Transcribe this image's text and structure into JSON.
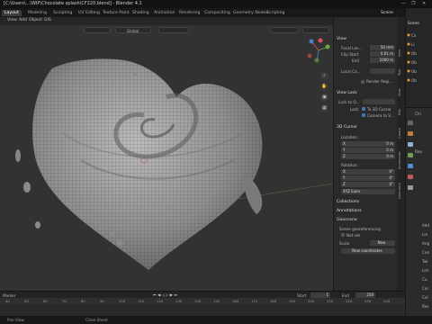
{
  "window": {
    "title": "[C:\\Users\\...\\WIP\\Chocolate splash\\CF220.blend] - Blender 4.1",
    "controls": [
      "—",
      "❐",
      "✕"
    ]
  },
  "workspace_tabs": [
    {
      "label": "Layout",
      "active": true
    },
    {
      "label": "Modeling",
      "active": false
    },
    {
      "label": "Sculpting",
      "active": false
    },
    {
      "label": "UV Editing",
      "active": false
    },
    {
      "label": "Texture Paint",
      "active": false
    },
    {
      "label": "Shading",
      "active": false
    },
    {
      "label": "Animation",
      "active": false
    },
    {
      "label": "Rendering",
      "active": false
    },
    {
      "label": "Compositing",
      "active": false
    },
    {
      "label": "Geometry Nodes",
      "active": false
    },
    {
      "label": "Scripting",
      "active": false
    }
  ],
  "scene_label": "Scene",
  "viewport_menu": [
    "View",
    "Add",
    "Object",
    "GIS"
  ],
  "transform_orientation": "Global",
  "n_panel": {
    "view_header": "View",
    "focal_label": "Focal Len...",
    "focal_value": "50 mm",
    "clip_header": "Clip Start",
    "clip_start_value": "0.01 m",
    "clip_end_label": "End",
    "clip_end_value": "1000 m",
    "local_camera_label": "Local Ca...",
    "render_region_label": "Render Regi...",
    "view_lock_header": "View Lock",
    "lock_to_obj_label": "Lock to O...",
    "lock_label": "Lock",
    "to_3d_cursor": "To 3D Cursor",
    "camera_to_view": "Camera to V...",
    "cursor_header": "3D Cursor",
    "location_label": "Location:",
    "loc_x": "X",
    "loc_x_val": "0 m",
    "loc_y": "Y",
    "loc_y_val": "0 m",
    "loc_z": "Z",
    "loc_z_val": "0 m",
    "rotation_label": "Rotation:",
    "rot_x": "X",
    "rot_x_val": "0°",
    "rot_y": "Y",
    "rot_y_val": "0°",
    "rot_z": "Z",
    "rot_z_val": "0°",
    "rotation_mode": "XYZ Euler",
    "collections_header": "Collections",
    "annotations_header": "Annotations",
    "georeferencing_header": "Geoscene",
    "geo_row1": "Scene georeferencing",
    "geo_row2": "Not set",
    "geo_crs_label": "Scale",
    "geo_new_btn": "New",
    "geo_row3": "New coordinates"
  },
  "side_tabs": [
    "Item",
    "Tool",
    "View",
    "Edit",
    "Create",
    "Screencast",
    "Geometry"
  ],
  "outliner_items": [
    "Scene",
    "Ca",
    "Li",
    "Ob",
    "Ob",
    "Ob",
    "Ob"
  ],
  "props_items": [
    "Chi",
    "Rea",
    "Add",
    "Lin",
    "Ang",
    "Con",
    "Twi",
    "Lim",
    "Cu",
    "Col",
    "Col",
    "Res"
  ],
  "timeline": {
    "marker_label": "Marker",
    "ticks": [
      "40",
      "50",
      "60",
      "70",
      "80",
      "90",
      "100",
      "110",
      "120",
      "130",
      "140",
      "150",
      "160",
      "170",
      "180",
      "190",
      "200",
      "210",
      "220",
      "230",
      "240"
    ],
    "start_label": "Start",
    "start_value": "1",
    "end_label": "End",
    "end_value": "250"
  },
  "status": {
    "left": "Pan View",
    "right": "Close Sheet"
  },
  "colors": {
    "accent": "#4772b3",
    "mesh_fill": "#9a9a9a",
    "wire": "#2b2b2b"
  }
}
